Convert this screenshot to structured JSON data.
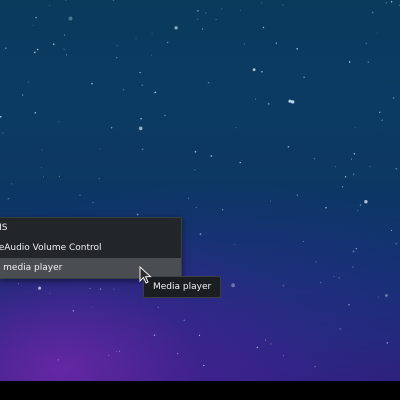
{
  "menu": {
    "items": [
      {
        "label": "MS"
      },
      {
        "label": "seAudio Volume Control"
      },
      {
        "label": "C media player",
        "selected": true
      }
    ]
  },
  "tooltip": {
    "text": "Media player"
  },
  "colors": {
    "menu_bg": "#232629",
    "menu_selected": "#4a4e53",
    "text": "#eff0f1",
    "taskbar": "#000000"
  },
  "icons": {
    "cursor": "arrow-pointer-icon"
  }
}
